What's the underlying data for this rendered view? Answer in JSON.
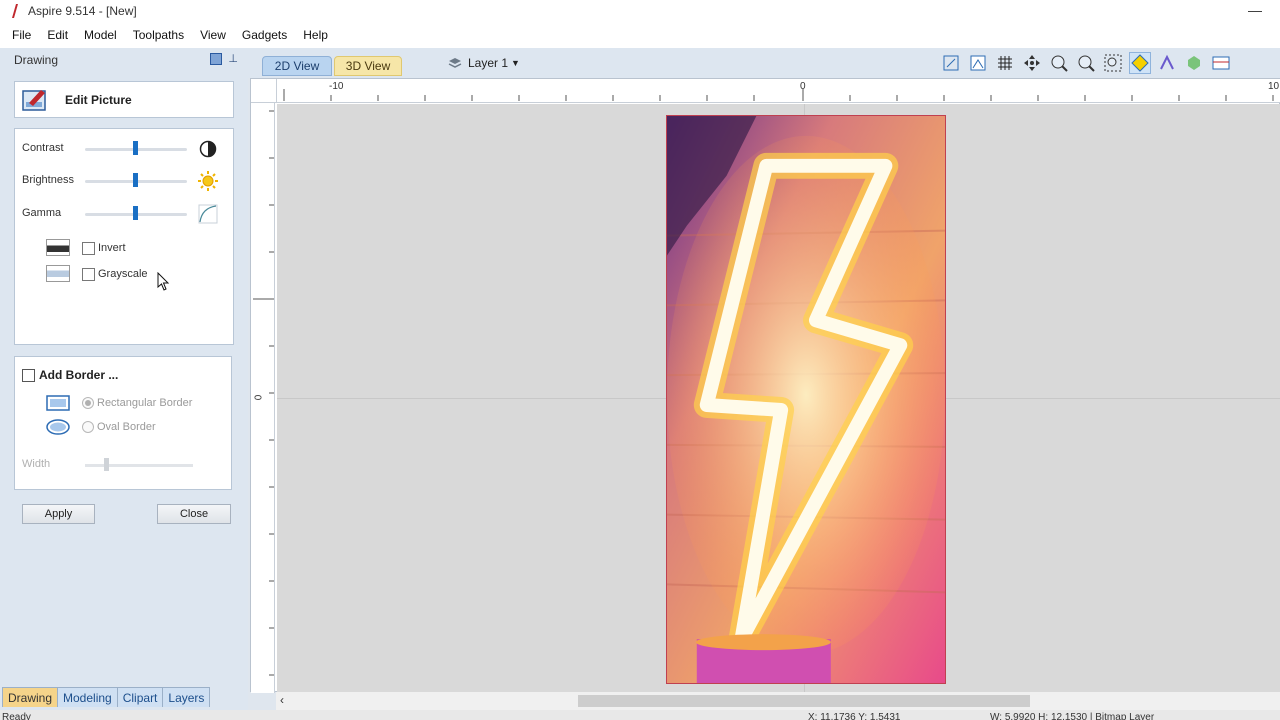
{
  "window": {
    "title": "Aspire 9.514 - [New]",
    "minimize_glyph": "—"
  },
  "menu": [
    "File",
    "Edit",
    "Model",
    "Toolpaths",
    "View",
    "Gadgets",
    "Help"
  ],
  "panel": {
    "header": "Drawing",
    "edit_picture_label": "Edit Picture",
    "sliders": [
      {
        "label": "Contrast",
        "icon": "contrast-icon",
        "value_percent": 50
      },
      {
        "label": "Brightness",
        "icon": "sun-icon",
        "value_percent": 50
      },
      {
        "label": "Gamma",
        "icon": "gamma-curve-icon",
        "value_percent": 50
      }
    ],
    "checks": [
      {
        "label": "Invert",
        "checked": false
      },
      {
        "label": "Grayscale",
        "checked": false
      }
    ],
    "border": {
      "title": "Add Border ...",
      "checked": false,
      "options": [
        {
          "label": "Rectangular Border",
          "selected": true
        },
        {
          "label": "Oval Border",
          "selected": false
        }
      ],
      "width_label": "Width"
    },
    "apply_label": "Apply",
    "close_label": "Close"
  },
  "bottom_tabs": [
    "Drawing",
    "Modeling",
    "Clipart",
    "Layers"
  ],
  "view_tabs": {
    "tab_2d": "2D View",
    "tab_3d": "3D View"
  },
  "layer_selector": "Layer 1",
  "ruler": {
    "left_label": "-10",
    "center_label": "0",
    "right_label": "10",
    "vertical_zero": "0"
  },
  "colors": {
    "accent": "#1a6fc4",
    "active_tab": "#f5d48a",
    "canvas_bg": "#d9d9d9"
  },
  "status": {
    "left": "Ready",
    "coords": "X: 11.1736 Y: 1.5431",
    "dims": "W: 5.9920 H: 12.1530 | Bitmap Layer"
  }
}
